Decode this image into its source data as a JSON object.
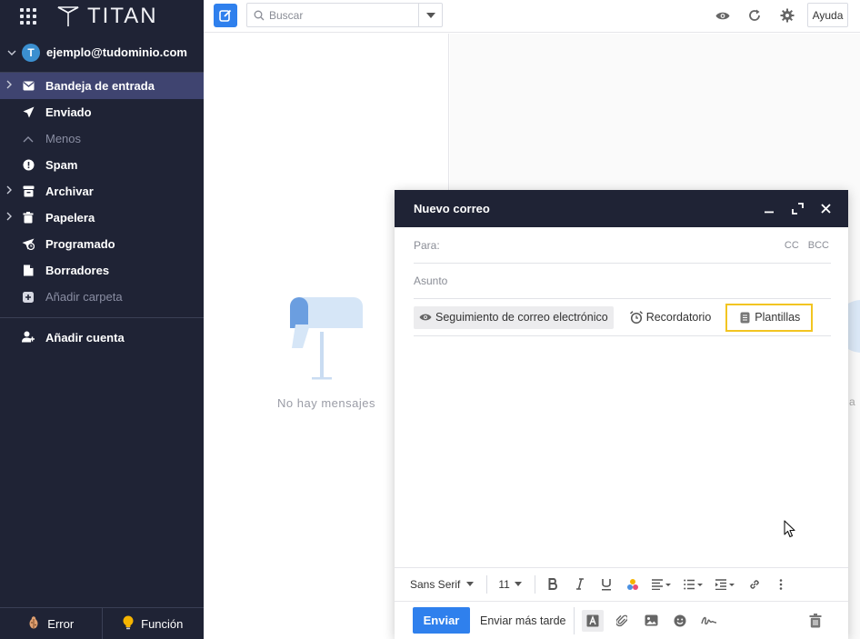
{
  "brand": {
    "name": "TITAN"
  },
  "account": {
    "initial": "T",
    "email": "ejemplo@tudominio.com"
  },
  "folders": [
    {
      "label": "Bandeja de entrada"
    },
    {
      "label": "Enviado"
    },
    {
      "label": "Menos"
    },
    {
      "label": "Spam"
    },
    {
      "label": "Archivar"
    },
    {
      "label": "Papelera"
    },
    {
      "label": "Programado"
    },
    {
      "label": "Borradores"
    },
    {
      "label": "Añadir carpeta"
    }
  ],
  "add_account": "Añadir cuenta",
  "sidebar_bottom": {
    "error": "Error",
    "feature": "Función"
  },
  "topbar": {
    "search_placeholder": "Buscar",
    "help": "Ayuda"
  },
  "list": {
    "empty": "No hay mensajes"
  },
  "reading": {
    "peek_text": "a"
  },
  "compose": {
    "title": "Nuevo correo",
    "to_label": "Para:",
    "cc": "CC",
    "bcc": "BCC",
    "subject_placeholder": "Asunto",
    "options": {
      "tracking": "Seguimiento de correo electrónico",
      "reminder": "Recordatorio",
      "templates": "Plantillas"
    },
    "format": {
      "font": "Sans Serif",
      "size": "11"
    },
    "send": "Enviar",
    "send_later": "Enviar más tarde"
  },
  "colors": {
    "sidebar": "#1f2335",
    "active": "#3f4470",
    "accent": "#2f80ed",
    "highlight": "#f2c521"
  }
}
